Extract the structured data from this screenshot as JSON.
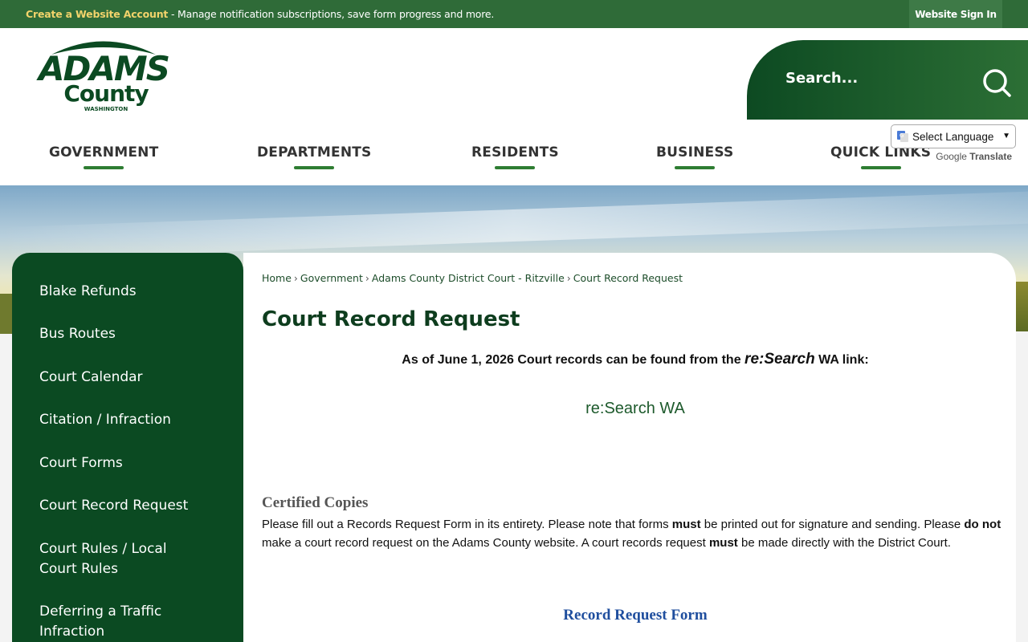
{
  "topbar": {
    "create_account": "Create a Website Account",
    "message": " - Manage notification subscriptions, save form progress and more.",
    "sign_in": "Website Sign In"
  },
  "logo": {
    "line1": "ADAMS",
    "line2": "County",
    "line3": "WASHINGTON"
  },
  "search": {
    "placeholder": "Search..."
  },
  "nav": {
    "items": [
      "GOVERNMENT",
      "DEPARTMENTS",
      "RESIDENTS",
      "BUSINESS",
      "QUICK LINKS"
    ]
  },
  "translate": {
    "select_label": "Select Language",
    "google": "Google",
    "translate": "Translate"
  },
  "sidebar": {
    "items": [
      "Blake Refunds",
      "Bus Routes",
      "Court Calendar",
      "Citation / Infraction",
      "Court Forms",
      "Court Record Request",
      "Court Rules / Local Court Rules",
      "Deferring a Traffic Infraction"
    ]
  },
  "breadcrumb": {
    "items": [
      "Home",
      "Government",
      "Adams County District Court - Ritzville",
      "Court Record Request"
    ],
    "separator": "›"
  },
  "page": {
    "title": "Court Record Request",
    "notice_prefix": "As of June 1, 2026 Court records can be found from the ",
    "notice_italic": "re:Search",
    "notice_suffix": " WA link:",
    "research_link": "re:Search WA",
    "certified_heading": "Certified Copies",
    "para_1": "Please fill out a Records Request Form in its entirety. Please note that forms ",
    "para_must1": "must",
    "para_2": " be printed out for signature and sending. Please ",
    "para_do_not": "do not",
    "para_3": " make a court record request on the Adams County website. A court records request ",
    "para_must2": "must",
    "para_4": " be made directly with the District Court.",
    "record_request_form": "Record Request Form"
  },
  "colors": {
    "brand_green": "#0b4a22",
    "topbar_green": "#2f6b38",
    "accent_yellow": "#f2d36b",
    "link_blue": "#1f4e9e"
  }
}
